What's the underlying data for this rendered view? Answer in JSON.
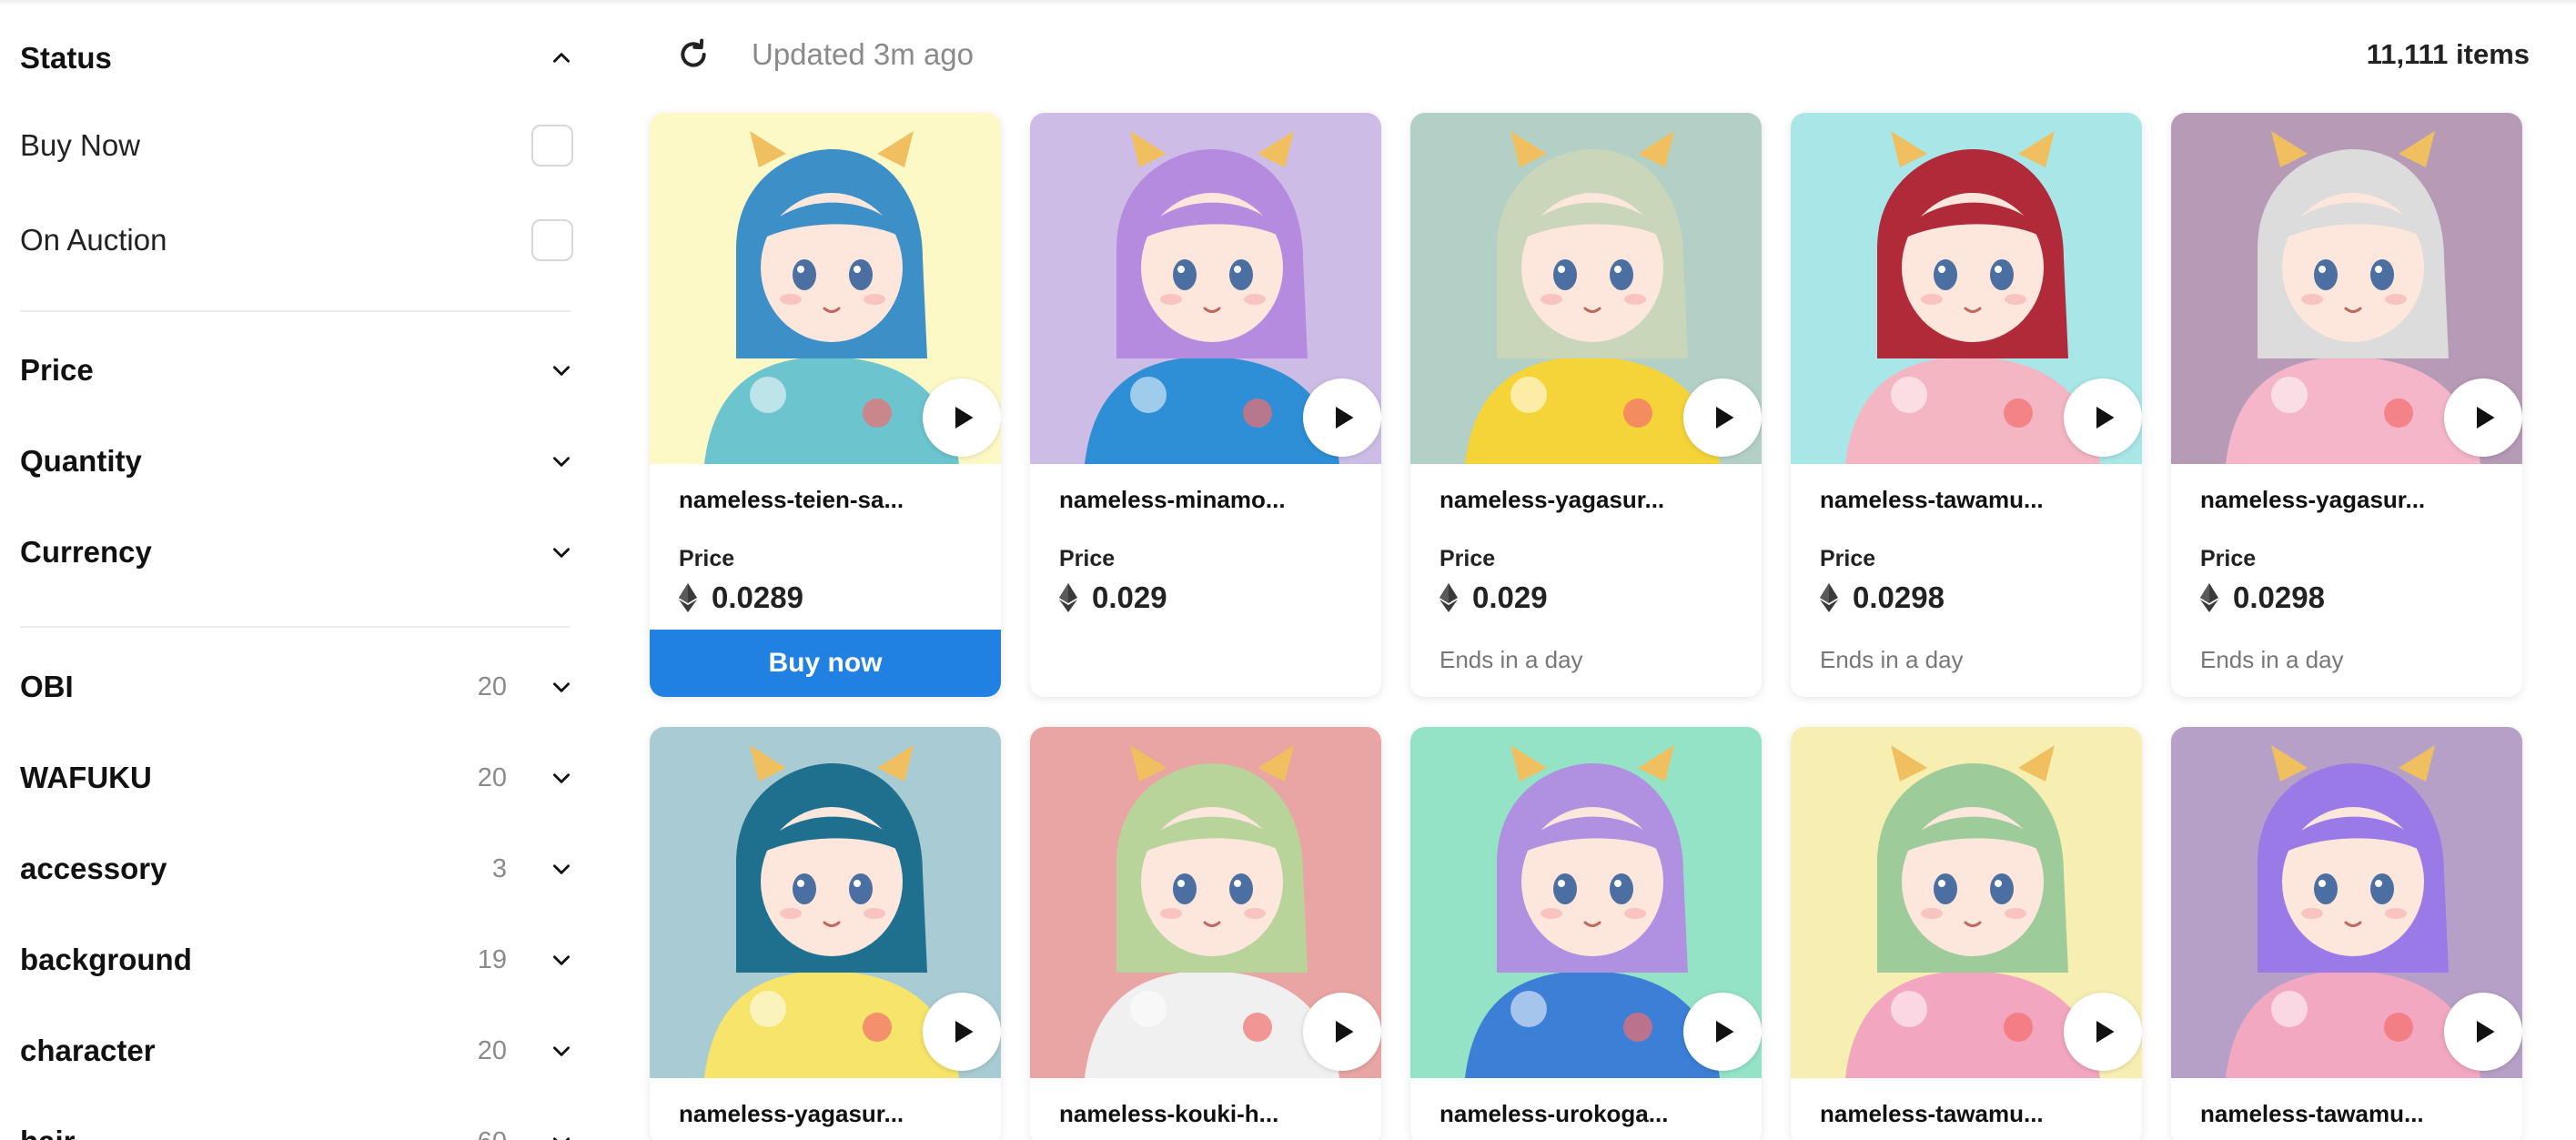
{
  "sidebar": {
    "status": {
      "title": "Status",
      "options": [
        "Buy Now",
        "On Auction"
      ]
    },
    "filters": [
      "Price",
      "Quantity",
      "Currency"
    ],
    "traits": [
      {
        "name": "OBI",
        "count": "20"
      },
      {
        "name": "WAFUKU",
        "count": "20"
      },
      {
        "name": "accessory",
        "count": "3"
      },
      {
        "name": "background",
        "count": "19"
      },
      {
        "name": "character",
        "count": "20"
      },
      {
        "name": "hair",
        "count": "60"
      }
    ]
  },
  "toolbar": {
    "updated": "Updated 3m ago",
    "items": "11,111 items"
  },
  "cards": [
    {
      "name": "nameless-teien-sa...",
      "price_label": "Price",
      "price": "0.0289",
      "footer": "",
      "button": "Buy now",
      "bg": "#fdf9c6",
      "hair": "#3c8fc7",
      "kimono": "#6cc4cf"
    },
    {
      "name": "nameless-minamo...",
      "price_label": "Price",
      "price": "0.029",
      "footer": "",
      "button": "",
      "bg": "#cdbde6",
      "hair": "#b58be0",
      "kimono": "#2e8fd6"
    },
    {
      "name": "nameless-yagasur...",
      "price_label": "Price",
      "price": "0.029",
      "footer": "Ends in a day",
      "button": "",
      "bg": "#b3d0c7",
      "hair": "#c9d6ba",
      "kimono": "#f5d43a"
    },
    {
      "name": "nameless-tawamu...",
      "price_label": "Price",
      "price": "0.0298",
      "footer": "Ends in a day",
      "button": "",
      "bg": "#a8e6e8",
      "hair": "#b12a3a",
      "kimono": "#f4b6c2"
    },
    {
      "name": "nameless-yagasur...",
      "price_label": "Price",
      "price": "0.0298",
      "footer": "Ends in a day",
      "button": "",
      "bg": "#b69ab6",
      "hair": "#dcdcdc",
      "kimono": "#f4b6c8"
    },
    {
      "name": "nameless-yagasur...",
      "price_label": "",
      "price": "",
      "footer": "",
      "button": "",
      "bg": "#a9cbd3",
      "hair": "#1f6f8f",
      "kimono": "#f7e46a"
    },
    {
      "name": "nameless-kouki-h...",
      "price_label": "",
      "price": "",
      "footer": "",
      "button": "",
      "bg": "#e9a5a3",
      "hair": "#b9d49a",
      "kimono": "#f0f0f0"
    },
    {
      "name": "nameless-urokoga...",
      "price_label": "",
      "price": "",
      "footer": "",
      "button": "",
      "bg": "#95e3c6",
      "hair": "#b090e0",
      "kimono": "#3b7fd6"
    },
    {
      "name": "nameless-tawamu...",
      "price_label": "",
      "price": "",
      "footer": "",
      "button": "",
      "bg": "#f7efb2",
      "hair": "#9dcc9a",
      "kimono": "#f3a6bf"
    },
    {
      "name": "nameless-tawamu...",
      "price_label": "",
      "price": "",
      "footer": "",
      "button": "",
      "bg": "#b7a0c7",
      "hair": "#9a7ae6",
      "kimono": "#f2a8c0"
    }
  ],
  "icons": {
    "collapse": "chevron-up-icon",
    "expand": "chevron-down-icon",
    "refresh": "refresh-icon",
    "play": "play-icon",
    "currency": "eth-icon"
  },
  "colors": {
    "accent": "#2081e2"
  }
}
